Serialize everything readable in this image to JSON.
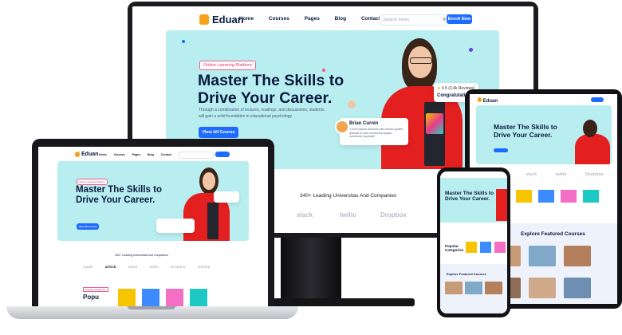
{
  "brand": {
    "name": "Eduan",
    "accent": "#1e6bff",
    "logo_color": "#f7a21b",
    "hero_bg": "#b9eef1",
    "shirt_red": "#e41f1f"
  },
  "nav": {
    "items": [
      "Home",
      "Courses",
      "Pages",
      "Blog",
      "Contact"
    ],
    "search_placeholder": "Search items",
    "enroll_label": "Enroll Now"
  },
  "hero": {
    "tag": "Online Learning Platform",
    "title_line1": "Master The Skills to",
    "title_line2": "Drive Your Career.",
    "subtitle_line1": "Through a combination of lectures, readings, and discussions, students",
    "subtitle_line2": "will gain a solid foundation in educational psychology.",
    "cta": "View All Course",
    "rating": "4.5 (3.4k Reviews)",
    "congrats": "Congratulations",
    "testimonial_name": "Brian Curnin",
    "testimonial_text": "\"Lorem ipsum dolorsus esto nectus quater quisque in dom consectus aquam commodo imperdiet\""
  },
  "partners": {
    "heading": "340+ Leading Universitas And Companies",
    "logos": [
      "slack",
      "twilio",
      "Dropbox"
    ]
  },
  "laptop": {
    "logos": [
      "Apple",
      "airbnb",
      "slack",
      "twilio",
      "Dropbox",
      "Gitship"
    ],
    "popular_tag": "Popular Categories",
    "popular_title": "Popu"
  },
  "tablet": {
    "logos": [
      "airbnb",
      "slack",
      "twilio",
      "Dropbox"
    ]
  },
  "phone": {
    "popular_title": "Popular Categories",
    "featured_tag": "Featured Courses",
    "featured_title": "Explore Featured Courses"
  },
  "featured": {
    "title": "Explore Featured Courses"
  },
  "icons": [
    "search-icon",
    "star-icon",
    "chat-icon",
    "sparkle-icon"
  ]
}
